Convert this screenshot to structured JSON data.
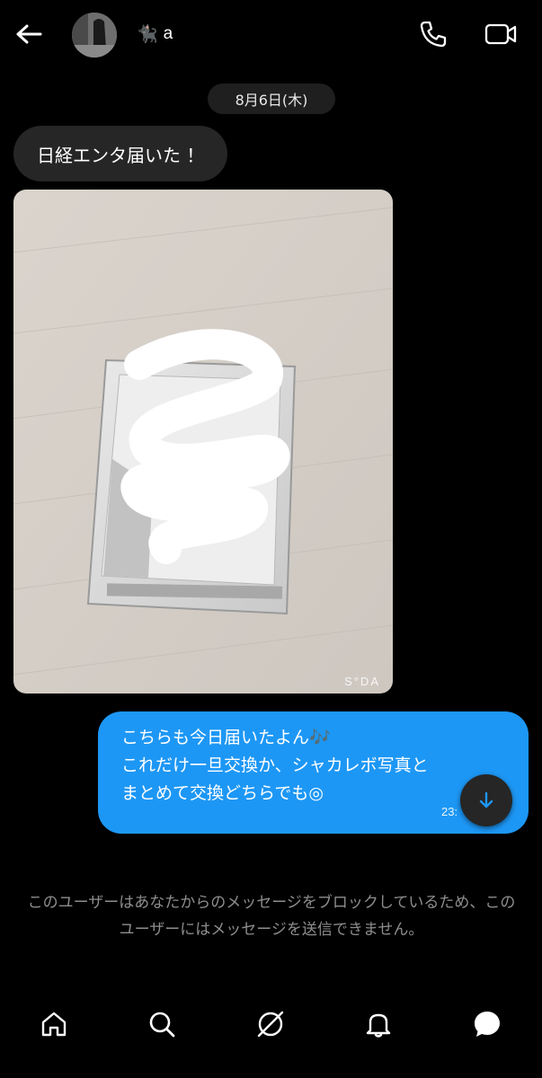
{
  "header": {
    "username": "a",
    "name_emoji": "🐈‍⬛",
    "icons": [
      "back-arrow-icon",
      "phone-icon",
      "video-camera-icon"
    ]
  },
  "date_separator": "8月6日(木)",
  "messages": [
    {
      "type": "text",
      "direction": "incoming",
      "text": "日経エンタ届いた ！"
    },
    {
      "type": "image",
      "direction": "incoming",
      "watermark": "S°DA"
    },
    {
      "type": "text",
      "direction": "outgoing",
      "lines": [
        "こちらも今日届いたよん🎶",
        "これだけ一旦交換か、シャカレボ写真と",
        "まとめて交換どちらでも◎"
      ],
      "time": "23:"
    }
  ],
  "blocked_notice": "このユーザーはあなたからのメッセージをブロックしているため、このユーザーにはメッセージを送信できません。",
  "colors": {
    "background": "#000000",
    "incoming_bubble": "#262626",
    "outgoing_bubble": "#1d97f5",
    "muted_text": "#8e8e8e"
  },
  "nav": {
    "icons": [
      "home-icon",
      "search-icon",
      "explore-icon",
      "notifications-bell-icon",
      "messages-icon"
    ]
  }
}
